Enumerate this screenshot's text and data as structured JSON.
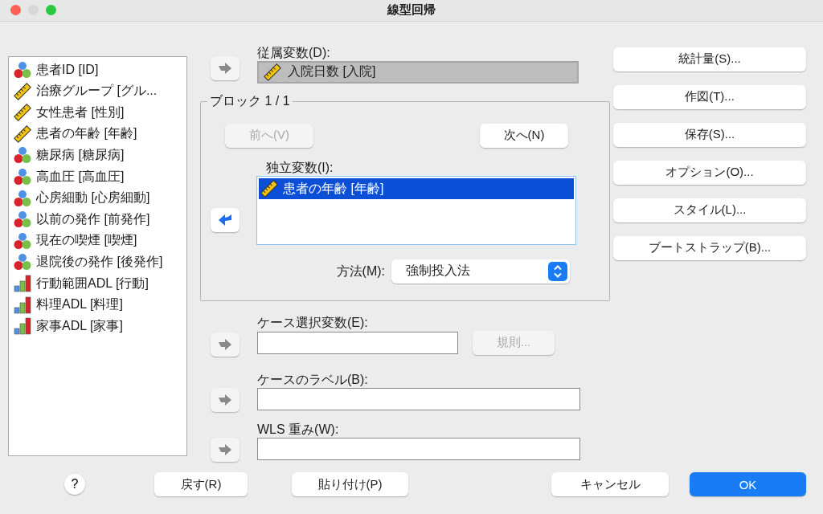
{
  "window": {
    "title": "線型回帰"
  },
  "variables": [
    {
      "label": "患者ID [ID]",
      "kind": "nominal"
    },
    {
      "label": "治療グループ [グル...",
      "kind": "scale"
    },
    {
      "label": "女性患者 [性別]",
      "kind": "scale"
    },
    {
      "label": "患者の年齢 [年齢]",
      "kind": "scale"
    },
    {
      "label": "糖尿病 [糖尿病]",
      "kind": "nominal"
    },
    {
      "label": "高血圧 [高血圧]",
      "kind": "nominal"
    },
    {
      "label": "心房細動 [心房細動]",
      "kind": "nominal"
    },
    {
      "label": "以前の発作 [前発作]",
      "kind": "nominal"
    },
    {
      "label": "現在の喫煙 [喫煙]",
      "kind": "nominal"
    },
    {
      "label": "退院後の発作 [後発作]",
      "kind": "nominal"
    },
    {
      "label": "行動範囲ADL [行動]",
      "kind": "ordinal"
    },
    {
      "label": "料理ADL [料理]",
      "kind": "ordinal"
    },
    {
      "label": "家事ADL [家事]",
      "kind": "ordinal"
    }
  ],
  "dependent": {
    "label": "従属変数(D):",
    "arrow": {
      "kind": "add",
      "disabled": true
    },
    "value": {
      "label": "入院日数 [入院]",
      "kind": "scale"
    }
  },
  "block": {
    "title": "ブロック 1 / 1",
    "prev": {
      "label": "前へ(V)",
      "disabled": true
    },
    "next": {
      "label": "次へ(N)",
      "disabled": false
    },
    "independent": {
      "label": "独立変数(I):",
      "arrow": {
        "kind": "remove",
        "disabled": false
      },
      "items": [
        {
          "label": "患者の年齢 [年齢]",
          "kind": "scale",
          "selected": true
        }
      ]
    },
    "method": {
      "label": "方法(M):",
      "value": "強制投入法"
    }
  },
  "case_selection": {
    "label": "ケース選択変数(E):",
    "arrow": {
      "kind": "add",
      "disabled": true
    },
    "rule_button": {
      "label": "規則...",
      "disabled": true
    }
  },
  "case_labels": {
    "label": "ケースのラベル(B):",
    "arrow": {
      "kind": "add",
      "disabled": true
    }
  },
  "wls_weight": {
    "label": "WLS 重み(W):",
    "arrow": {
      "kind": "add",
      "disabled": true
    }
  },
  "side_buttons": [
    "統計量(S)...",
    "作図(T)...",
    "保存(S)...",
    "オプション(O)...",
    "スタイル(L)...",
    "ブートストラップ(B)..."
  ],
  "footer": {
    "help": "?",
    "buttons": [
      {
        "label": "戻す(R)",
        "kind": "normal"
      },
      {
        "label": "貼り付け(P)",
        "kind": "normal"
      },
      {
        "label": "キャンセル",
        "kind": "normal"
      },
      {
        "label": "OK",
        "kind": "default"
      }
    ]
  }
}
